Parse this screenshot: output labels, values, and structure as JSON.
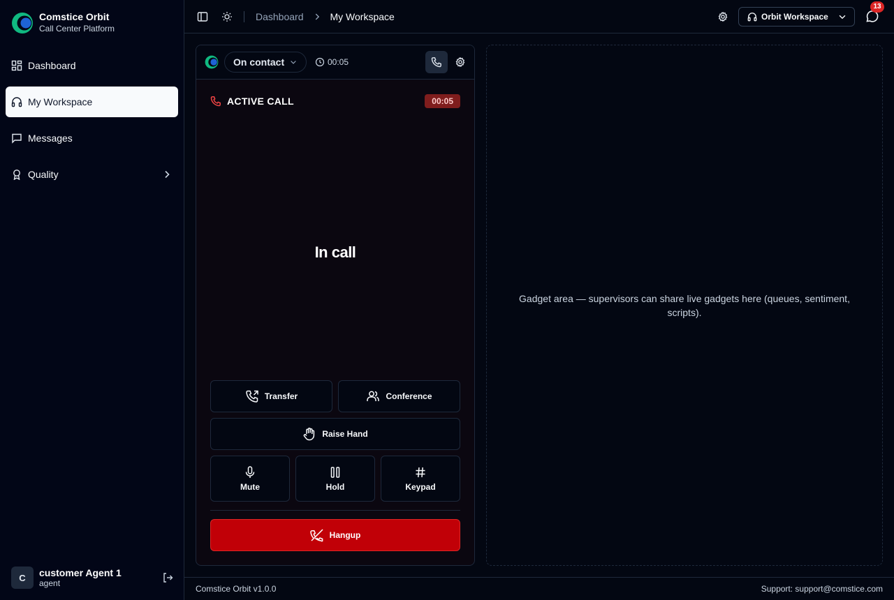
{
  "brand": {
    "name": "Comstice Orbit",
    "subtitle": "Call Center Platform"
  },
  "sidebar": {
    "items": [
      {
        "label": "Dashboard",
        "icon": "dashboard-grid-icon",
        "active": false
      },
      {
        "label": "My Workspace",
        "icon": "headphones-icon",
        "active": true
      },
      {
        "label": "Messages",
        "icon": "message-square-icon",
        "active": false
      },
      {
        "label": "Quality",
        "icon": "award-icon",
        "active": false,
        "has_children": true
      }
    ]
  },
  "user": {
    "initial": "C",
    "name": "customer Agent 1",
    "role": "agent"
  },
  "header": {
    "breadcrumb": [
      "Dashboard",
      "My Workspace"
    ],
    "workspace_select": "Orbit Workspace",
    "notification_count": "13"
  },
  "call_panel": {
    "status": "On contact",
    "status_timer": "00:05",
    "active_label": "ACTIVE CALL",
    "active_timer": "00:05",
    "state_text": "In call",
    "buttons": {
      "transfer": "Transfer",
      "conference": "Conference",
      "raise_hand": "Raise Hand",
      "mute": "Mute",
      "hold": "Hold",
      "keypad": "Keypad",
      "hangup": "Hangup"
    }
  },
  "gadget": {
    "text": "Gadget area — supervisors can share live gadgets here (queues, sentiment, scripts)."
  },
  "footer": {
    "version": "Comstice Orbit v1.0.0",
    "support": "Support: support@comstice.com"
  },
  "colors": {
    "background": "#030712",
    "hangup": "#c10007",
    "timer_badge": "#7f1d1d",
    "accent_teal": "#10b981",
    "accent_blue": "#1e63d6"
  }
}
